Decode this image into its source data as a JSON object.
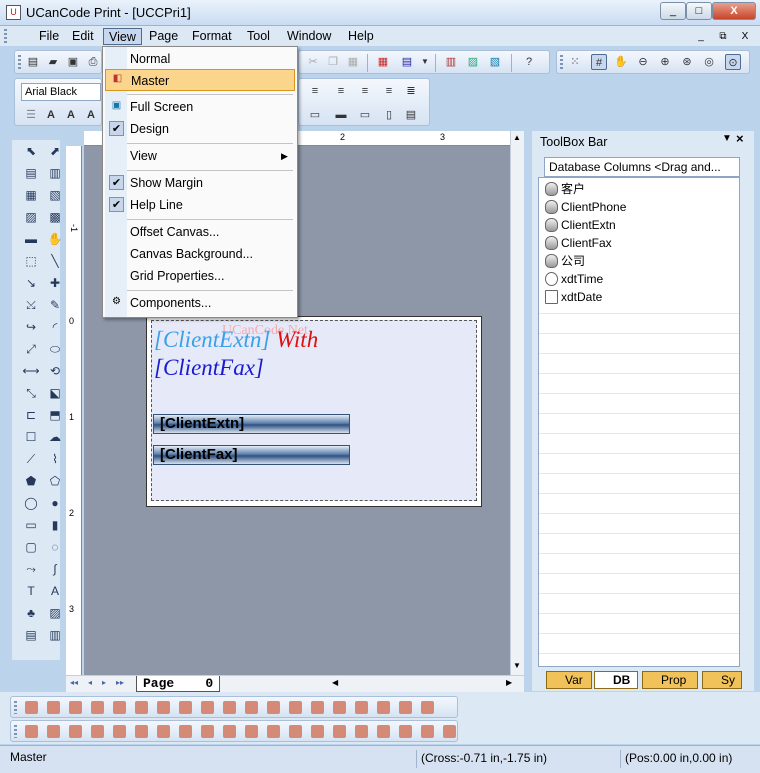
{
  "title": "UCanCode Print - [UCCPri1]",
  "window_buttons": {
    "min": "_",
    "max": "□",
    "close": "X"
  },
  "menubar": [
    "File",
    "Edit",
    "View",
    "Page",
    "Format",
    "Tool",
    "Window",
    "Help"
  ],
  "mdi_buttons": [
    "_",
    "⧉",
    "X"
  ],
  "font": {
    "name": "Arial Black"
  },
  "view_menu": [
    {
      "label": "Normal"
    },
    {
      "label": "Master"
    },
    {
      "label": "Full Screen"
    },
    {
      "label": "Design"
    },
    {
      "label": "View"
    },
    {
      "label": "Show Margin"
    },
    {
      "label": "Help Line"
    },
    {
      "label": "Offset Canvas..."
    },
    {
      "label": "Canvas Background..."
    },
    {
      "label": "Grid Properties..."
    },
    {
      "label": "Components..."
    }
  ],
  "canvas": {
    "watermark": "UCanCode.Net",
    "line1a": "[ClientExtn]",
    "line1b": "With",
    "line2": "[ClientFax]",
    "bar1": "[ClientExtn]",
    "bar2": "[ClientFax]",
    "page_tab": "Page    0"
  },
  "rulers": {
    "top": [
      "1",
      "2",
      "3"
    ],
    "left": [
      "-1",
      "0",
      "1",
      "2",
      "3"
    ]
  },
  "toolbox": {
    "title": "ToolBox Bar",
    "header": "Database Columns <Drag and...",
    "items": [
      "客户",
      "ClientPhone",
      "ClientExtn",
      "ClientFax",
      "公司",
      "xdtTime",
      "xdtDate"
    ],
    "tabs": [
      "Var",
      "DB",
      "Prop",
      "Sy"
    ]
  },
  "status": {
    "mode": "Master",
    "cross": "(Cross:-0.71 in,-1.75 in)",
    "pos": "(Pos:0.00 in,0.00 in)"
  }
}
